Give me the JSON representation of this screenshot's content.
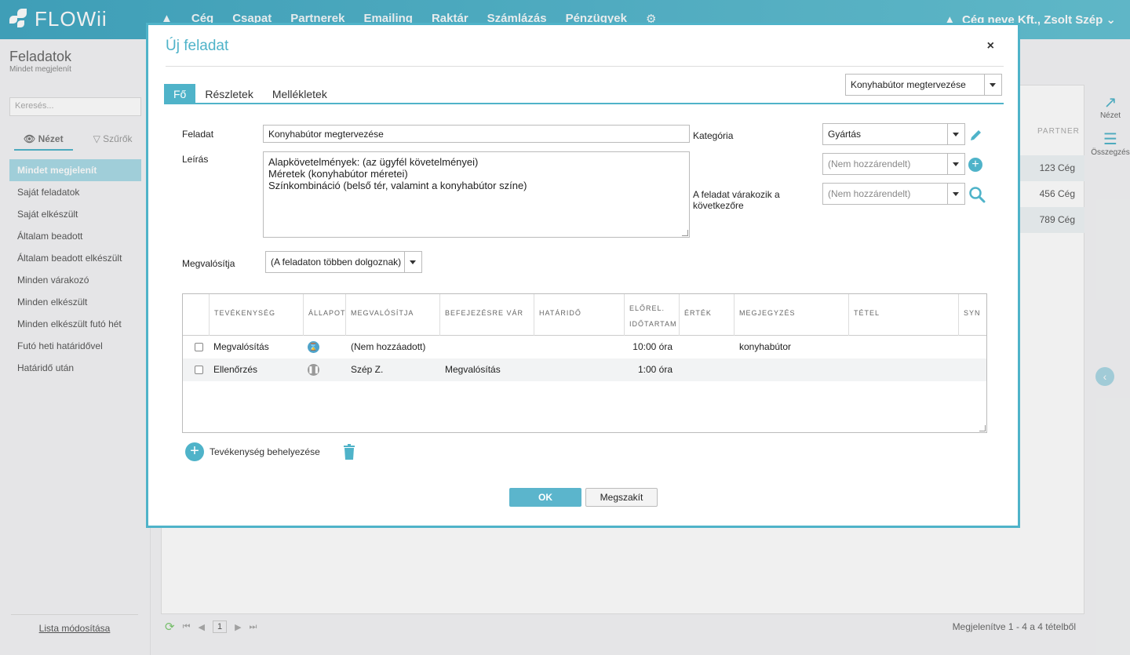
{
  "app": {
    "name": "FLOWii"
  },
  "topnav": {
    "items": [
      "Cég",
      "Csapat",
      "Partnerek",
      "Emailing",
      "Raktár",
      "Számlázás",
      "Pénzügyek"
    ],
    "user": "Cég neve Kft., Zsolt Szép"
  },
  "sidebar": {
    "title": "Feladatok",
    "subtitle": "Mindet megjelenít",
    "search_placeholder": "Keresés...",
    "tabs": {
      "view": "Nézet",
      "filters": "Szűrők"
    },
    "items": [
      {
        "label": "Mindet megjelenít",
        "active": true
      },
      {
        "label": "Saját feladatok"
      },
      {
        "label": "Saját elkészült"
      },
      {
        "label": "Általam beadott"
      },
      {
        "label": "Általam beadott elkészült"
      },
      {
        "label": "Minden várakozó"
      },
      {
        "label": "Minden elkészült"
      },
      {
        "label": "Minden elkészült futó hét"
      },
      {
        "label": "Futó heti határidővel"
      },
      {
        "label": "Határidő után"
      }
    ],
    "footer_link": "Lista módosítása"
  },
  "background": {
    "partner_header": "PARTNER",
    "partner_rows": [
      "123 Cég",
      "456 Cég",
      "789 Cég"
    ],
    "right_tools": {
      "view": "Nézet",
      "summary": "Összegzés"
    },
    "pager": {
      "page": "1",
      "info": "Megjelenítve 1 - 4 a 4 tételből"
    }
  },
  "modal": {
    "title": "Új feladat",
    "tabs": [
      "Fő",
      "Részletek",
      "Mellékletek"
    ],
    "task_select": "Konyhabútor megtervezése",
    "form": {
      "task_label": "Feladat",
      "task_value": "Konyhabútor megtervezése",
      "desc_label": "Leírás",
      "desc_lines": [
        "Alapkövetelmények: (az ügyfél követelményei)",
        "Méretek (konyhabútor méretei)",
        "Színkombináció (belső tér, valamint a konyhabútor színe)"
      ],
      "category_label": "Kategória",
      "category_value": "Gyártás",
      "second_select": "(Nem hozzárendelt)",
      "waits_label_1": "A feladat várakozik a",
      "waits_label_2": "következőre",
      "waits_value": "(Nem hozzárendelt)",
      "performer_label": "Megvalósítja",
      "performer_value": "(A feladaton többen dolgoznak)"
    },
    "grid": {
      "headers": {
        "activity": "TEVÉKENYSÉG",
        "status": "ÁLLAPOT",
        "performer": "MEGVALÓSÍTJA",
        "waits": "BEFEJEZÉSRE VÁR",
        "deadline": "HATÁRIDŐ",
        "duration_1": "ELŐREL.",
        "duration_2": "IDŐTARTAM",
        "value": "ÉRTÉK",
        "note": "MEGJEGYZÉS",
        "item": "TÉTEL",
        "syn": "SYN"
      },
      "rows": [
        {
          "activity": "Megvalósítás",
          "status_color": "#4fa3c9",
          "performer": "(Nem hozzáadott)",
          "waits": "",
          "duration": "10:00 óra",
          "note": "konyhabútor"
        },
        {
          "activity": "Ellenőrzés",
          "status_color": "#9a9a9a",
          "performer": "Szép Z.",
          "waits": "Megvalósítás",
          "duration": "1:00 óra",
          "note": ""
        }
      ]
    },
    "add_activity": "Tevékenység behelyezése",
    "ok": "OK",
    "cancel": "Megszakít"
  }
}
